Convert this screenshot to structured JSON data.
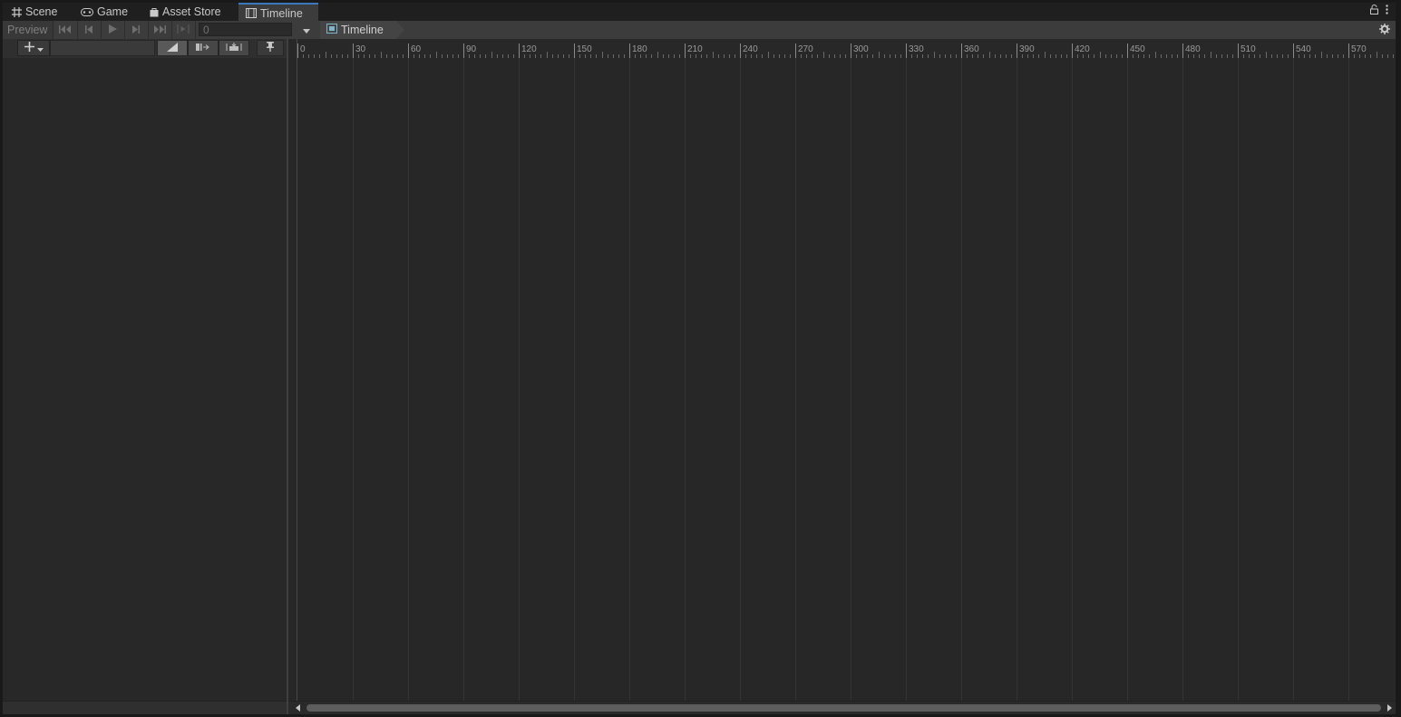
{
  "tabs": [
    {
      "label": "Scene",
      "icon": "grid-hash-icon"
    },
    {
      "label": "Game",
      "icon": "gamepad-icon"
    },
    {
      "label": "Asset Store",
      "icon": "shopping-bag-icon"
    },
    {
      "label": "Timeline",
      "icon": "film-strip-icon",
      "active": true
    }
  ],
  "toolbar": {
    "preview_label": "Preview",
    "frame_value": "0",
    "breadcrumb_label": "Timeline",
    "buttons": [
      "go-to-start-icon",
      "previous-frame-icon",
      "play-icon",
      "next-frame-icon",
      "go-to-end-icon",
      "play-range-icon"
    ]
  },
  "ruler": {
    "labels": [
      "0",
      "30",
      "60",
      "90",
      "120",
      "150",
      "180",
      "210",
      "240",
      "270",
      "300",
      "330",
      "360",
      "390",
      "420",
      "450",
      "480",
      "510",
      "540",
      "570"
    ]
  },
  "colors": {
    "accent": "#3a79bb",
    "background": "#282828",
    "toolbar": "#3c3c3c"
  }
}
